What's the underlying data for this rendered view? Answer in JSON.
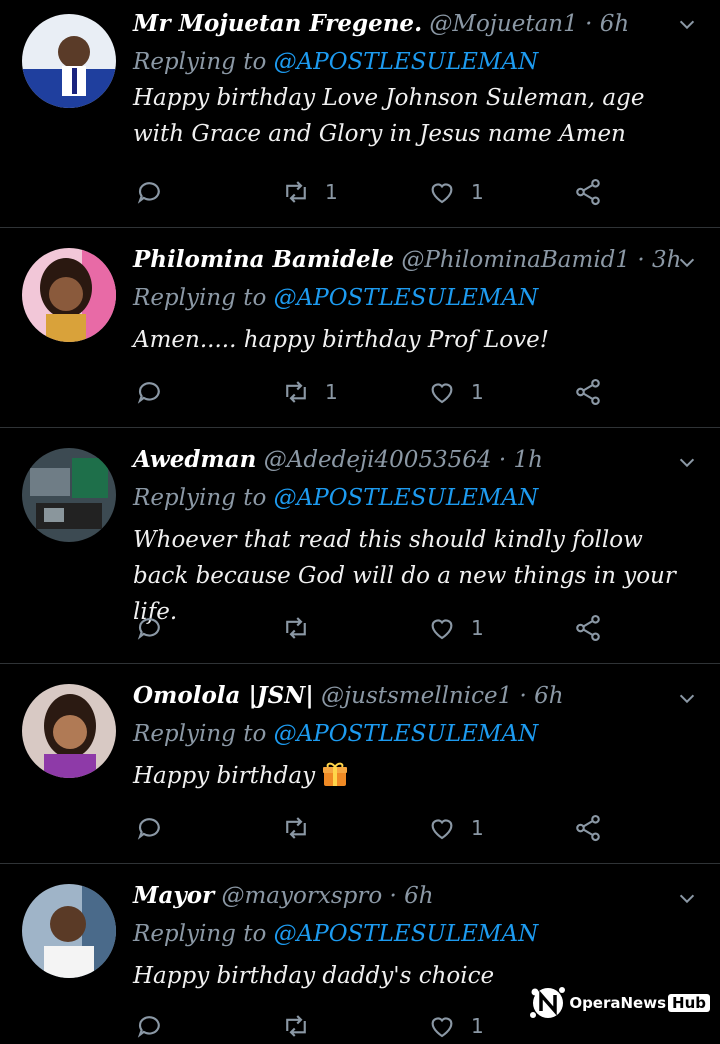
{
  "tweets": [
    {
      "name": "Mr Mojuetan Fregene.",
      "handle": "@Mojuetan1",
      "time": "6h",
      "replying_prefix": "Replying to",
      "mention": "@APOSTLESULEMAN",
      "body": "Happy birthday Love Johnson Suleman, age with Grace and Glory in Jesus name Amen",
      "retweets": "1",
      "likes": "1"
    },
    {
      "name": "Philomina Bamidele",
      "handle": "@PhilominaBamid1",
      "time": "3h",
      "replying_prefix": "Replying to",
      "mention": "@APOSTLESULEMAN",
      "body": "Amen..... happy birthday Prof Love!",
      "retweets": "1",
      "likes": "1"
    },
    {
      "name": "Awedman",
      "handle": "@Adedeji40053564",
      "time": "1h",
      "replying_prefix": "Replying to",
      "mention": "@APOSTLESULEMAN",
      "body": "Whoever that read this should kindly follow back because God will do a new things in your life.",
      "retweets": "",
      "likes": "1"
    },
    {
      "name": "Omolola |JSN|",
      "handle": "@justsmellnice1",
      "time": "6h",
      "replying_prefix": "Replying to",
      "mention": "@APOSTLESULEMAN",
      "body": "Happy birthday",
      "retweets": "",
      "likes": "1"
    },
    {
      "name": "Mayor",
      "handle": "@mayorxspro",
      "time": "6h",
      "replying_prefix": "Replying to",
      "mention": "@APOSTLESULEMAN",
      "body": "Happy birthday daddy's choice",
      "retweets": "",
      "likes": "1"
    }
  ],
  "separator": "·",
  "watermark": {
    "text": "OperaNews",
    "hub": "Hub"
  },
  "colors": {
    "background": "#000000",
    "mention": "#1d9bf0",
    "muted": "#8b98a5"
  }
}
